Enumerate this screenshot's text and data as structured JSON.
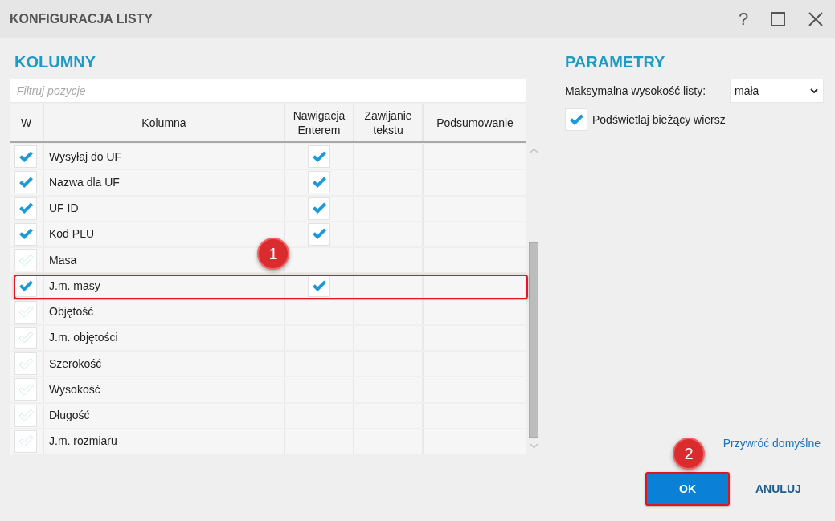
{
  "window": {
    "title": "KONFIGURACJA LISTY",
    "help_label": "?"
  },
  "columns_panel": {
    "heading": "KOLUMNY",
    "filter": {
      "placeholder": "Filtruj pozycje"
    },
    "table": {
      "columns": [
        "W",
        "Kolumna",
        "Nawigacja Enterem",
        "Zawijanie tekstu",
        "Podsumowanie"
      ],
      "rows": [
        {
          "name": "Wysyłaj do UF",
          "visible": true,
          "enter_navigation": true,
          "highlighted": false
        },
        {
          "name": "Nazwa dla UF",
          "visible": true,
          "enter_navigation": true,
          "highlighted": false
        },
        {
          "name": "UF ID",
          "visible": true,
          "enter_navigation": true,
          "highlighted": false
        },
        {
          "name": "Kod PLU",
          "visible": true,
          "enter_navigation": true,
          "highlighted": false
        },
        {
          "name": "Masa",
          "visible": false,
          "enter_navigation": false,
          "highlighted": false
        },
        {
          "name": "J.m. masy",
          "visible": true,
          "enter_navigation": true,
          "highlighted": true,
          "marker": "1"
        },
        {
          "name": "Objętość",
          "visible": false,
          "enter_navigation": false,
          "highlighted": false
        },
        {
          "name": "J.m. objętości",
          "visible": false,
          "enter_navigation": false,
          "highlighted": false
        },
        {
          "name": "Szerokość",
          "visible": false,
          "enter_navigation": false,
          "highlighted": false
        },
        {
          "name": "Wysokość",
          "visible": false,
          "enter_navigation": false,
          "highlighted": false
        },
        {
          "name": "Długość",
          "visible": false,
          "enter_navigation": false,
          "highlighted": false
        },
        {
          "name": "J.m. rozmiaru",
          "visible": false,
          "enter_navigation": false,
          "highlighted": false
        }
      ]
    }
  },
  "parameters_panel": {
    "heading": "PARAMETRY",
    "max_height": {
      "label": "Maksymalna wysokość listy:",
      "value": "mała"
    },
    "highlight_current_row": {
      "label": "Podświetlaj bieżący wiersz",
      "checked": true
    }
  },
  "footer": {
    "restore_link": "Przywróć domyślne",
    "ok_button": {
      "label": "OK",
      "highlighted": true,
      "marker": "2"
    },
    "cancel_button": {
      "label": "ANULUJ"
    }
  }
}
